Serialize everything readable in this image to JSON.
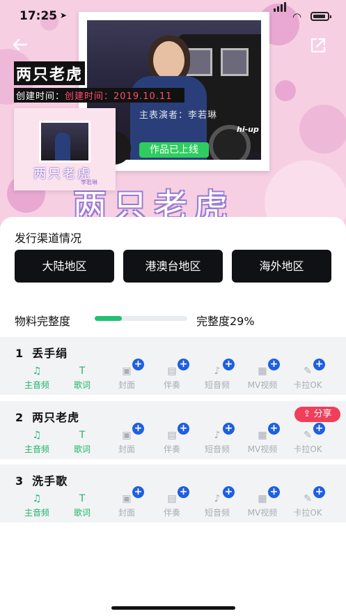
{
  "status_bar": {
    "time": "17:25",
    "location_glyph": "➤"
  },
  "hero": {
    "song_title": "两只老虎",
    "created_prefix": "创建时间：",
    "created_value": "创建时间：2019.10.11",
    "performer": "主表演者：李若琳",
    "badge": "作品已上线",
    "cover_text": "两只老虎",
    "cover_sub": "李若琳",
    "watermark": "hi-up",
    "big_title": "两只老虎"
  },
  "distribution": {
    "title": "发行渠道情况",
    "channels": [
      "大陆地区",
      "港澳台地区",
      "海外地区"
    ]
  },
  "completeness": {
    "label": "物料完整度",
    "percent": 29,
    "text": "完整度29%"
  },
  "songs": [
    {
      "index": "1",
      "name": "丢手绢",
      "share": ""
    },
    {
      "index": "2",
      "name": "两只老虎",
      "share": "分享"
    },
    {
      "index": "3",
      "name": "洗手歌",
      "share": ""
    }
  ],
  "material_items": [
    {
      "label": "主音频",
      "icon": "music-note-icon",
      "glyph": "♫",
      "state": "active"
    },
    {
      "label": "歌词",
      "icon": "lyrics-icon",
      "glyph": "T",
      "state": "active"
    },
    {
      "label": "封面",
      "icon": "image-icon",
      "glyph": "▣",
      "state": "inactive"
    },
    {
      "label": "伴奏",
      "icon": "accompaniment-icon",
      "glyph": "▤",
      "state": "inactive"
    },
    {
      "label": "短音频",
      "icon": "short-audio-icon",
      "glyph": "♪",
      "state": "inactive"
    },
    {
      "label": "MV视频",
      "icon": "video-icon",
      "glyph": "▦",
      "state": "inactive"
    },
    {
      "label": "卡拉OK",
      "icon": "microphone-icon",
      "glyph": "✎",
      "state": "inactive"
    }
  ],
  "colors": {
    "accent_green": "#1fc173",
    "share_red": "#ef3f5b",
    "plus_blue": "#1f5fe0",
    "channel_dark": "#101114"
  }
}
